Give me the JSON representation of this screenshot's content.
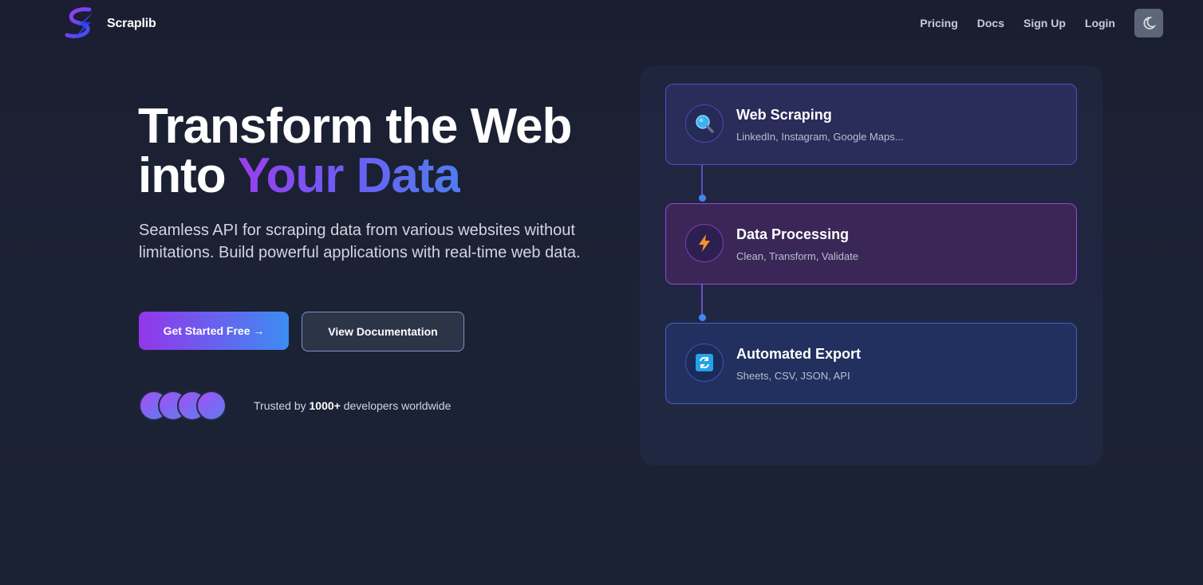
{
  "header": {
    "brand_name": "Scraplib",
    "nav": {
      "pricing": "Pricing",
      "docs": "Docs",
      "signup": "Sign Up",
      "login": "Login"
    },
    "theme_toggle_icon": "moon-stars-icon"
  },
  "hero": {
    "title_line1": "Transform the Web",
    "title_line2_prefix": "into",
    "title_highlight": "Your Data",
    "subtitle": "Seamless API for scraping data from various websites without limitations. Build powerful applications with real-time web data.",
    "primary_button": "Get Started Free →",
    "secondary_button": "View Documentation",
    "trusted_prefix": "Trusted by",
    "trusted_count": "1000+",
    "trusted_suffix": "developers worldwide",
    "avatar_count": 4
  },
  "pipeline": [
    {
      "title": "Web Scraping",
      "description": "LinkedIn, Instagram, Google Maps...",
      "icon": "magnifying-glass-icon"
    },
    {
      "title": "Data Processing",
      "description": "Clean, Transform, Validate",
      "icon": "lightning-icon"
    },
    {
      "title": "Automated Export",
      "description": "Sheets, CSV, JSON, API",
      "icon": "refresh-icon"
    }
  ],
  "colors": {
    "accent_purple": "#9336ea",
    "accent_blue": "#3d8cf2",
    "background": "#1b2033"
  }
}
